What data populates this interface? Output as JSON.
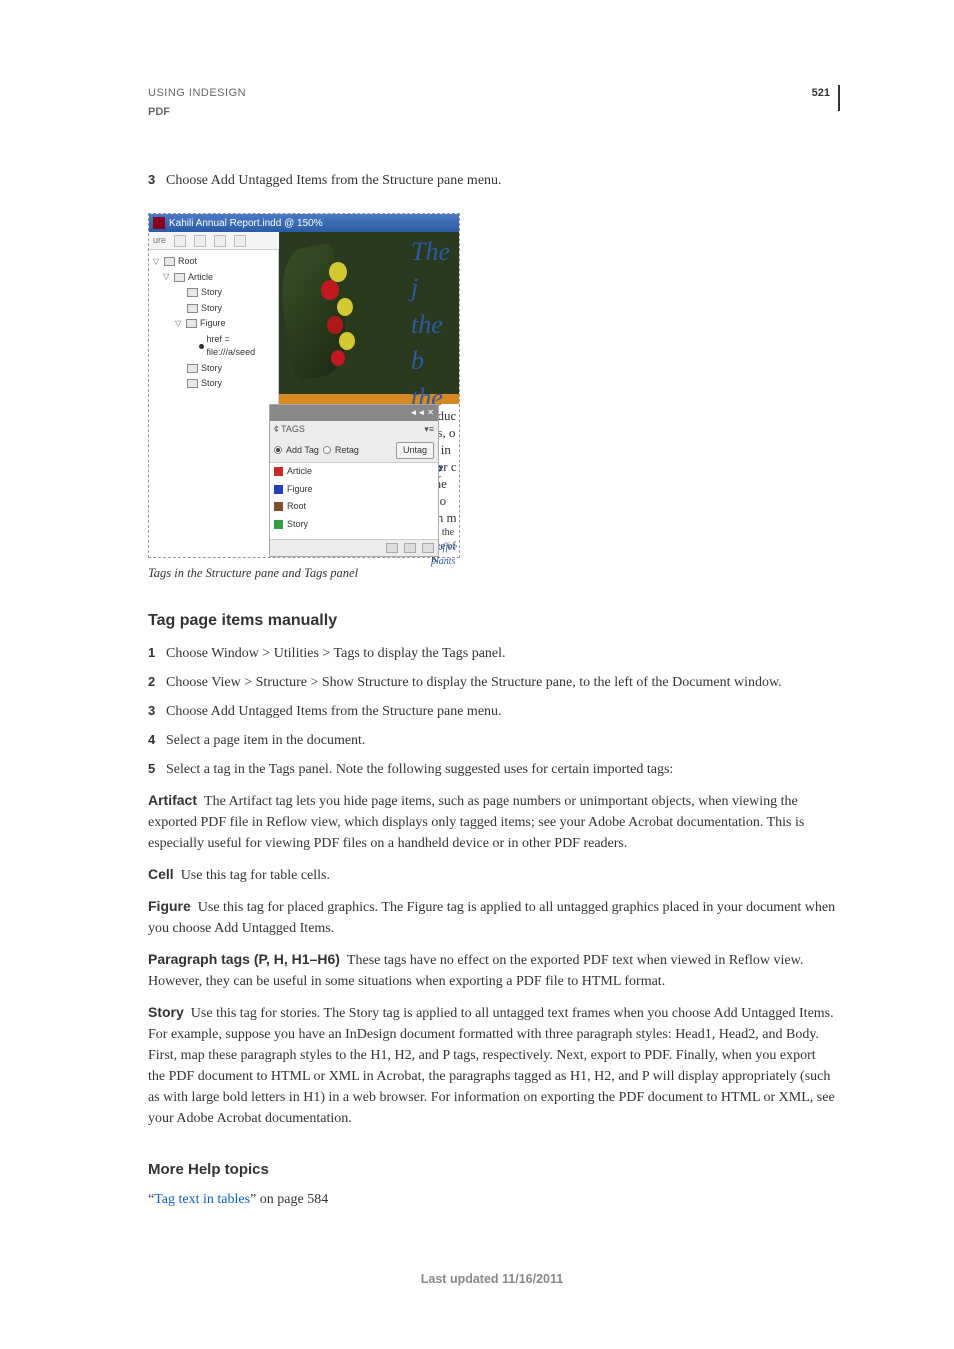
{
  "header": {
    "breadcrumb": "USING INDESIGN",
    "section": "PDF",
    "page_number": "521"
  },
  "step3_top": {
    "num": "3",
    "text": "Choose Add Untagged Items from the Structure pane menu."
  },
  "figure": {
    "caption": "Tags in the Structure pane and Tags panel",
    "titlebar": "Kahili Annual Report.indd @ 150%",
    "toolbar_left": "ure",
    "tree": {
      "root": "Root",
      "article": "Article",
      "story1": "Story",
      "story2": "Story",
      "figure_node": "Figure",
      "href": "href = file:///a/seed",
      "story3": "Story",
      "story4": "Story"
    },
    "serif_lines": {
      "l1": "The j",
      "l2": "the b",
      "l3": "the c",
      "l4": "the e"
    },
    "right_text": {
      "r1": "oduc",
      "r2": "ns, o",
      "r3": "d in",
      "r4": "her c",
      "r5": "the",
      "r6": "Co",
      "r7": "en m",
      "r8": "as the site of K",
      "r9": "Coffee plants"
    },
    "tags_panel": {
      "title_prefix": "¢",
      "title": "TAGS",
      "add_tag": "Add Tag",
      "retag": "Retag",
      "untag": "Untag",
      "items": [
        {
          "name": "Article",
          "color": "#d02828"
        },
        {
          "name": "Figure",
          "color": "#2040c0"
        },
        {
          "name": "Root",
          "color": "#805028"
        },
        {
          "name": "Story",
          "color": "#30a040"
        }
      ]
    }
  },
  "section": {
    "heading": "Tag page items manually",
    "steps": [
      {
        "num": "1",
        "text": "Choose Window > Utilities > Tags to display the Tags panel."
      },
      {
        "num": "2",
        "text": "Choose View > Structure > Show Structure to display the Structure pane, to the left of the Document window."
      },
      {
        "num": "3",
        "text": "Choose Add Untagged Items from the Structure pane menu."
      },
      {
        "num": "4",
        "text": "Select a page item in the document."
      },
      {
        "num": "5",
        "text": "Select a tag in the Tags panel. Note the following suggested uses for certain imported tags:"
      }
    ]
  },
  "definitions": [
    {
      "term": "Artifact",
      "body": "The Artifact tag lets you hide page items, such as page numbers or unimportant objects, when viewing the exported PDF file in Reflow view, which displays only tagged items; see your Adobe Acrobat documentation. This is especially useful for viewing PDF files on a handheld device or in other PDF readers."
    },
    {
      "term": "Cell",
      "body": "Use this tag for table cells."
    },
    {
      "term": "Figure",
      "body": "Use this tag for placed graphics. The Figure tag is applied to all untagged graphics placed in your document when you choose Add Untagged Items."
    },
    {
      "term": "Paragraph tags (P, H, H1–H6)",
      "body": "These tags have no effect on the exported PDF text when viewed in Reflow view. However, they can be useful in some situations when exporting a PDF file to HTML format."
    },
    {
      "term": "Story",
      "body": "Use this tag for stories. The Story tag is applied to all untagged text frames when you choose Add Untagged Items. For example, suppose you have an InDesign document formatted with three paragraph styles: Head1, Head2, and Body. First, map these paragraph styles to the H1, H2, and P tags, respectively. Next, export to PDF. Finally, when you export the PDF document to HTML or XML in Acrobat, the paragraphs tagged as H1, H2, and P will display appropriately (such as with large bold letters in H1) in a web browser. For information on exporting the PDF document to HTML or XML, see your Adobe Acrobat documentation."
    }
  ],
  "help": {
    "heading": "More Help topics",
    "quote_open": "“",
    "link_text": "Tag text in tables",
    "quote_close_suffix": "” on page 584"
  },
  "footer": "Last updated 11/16/2011"
}
